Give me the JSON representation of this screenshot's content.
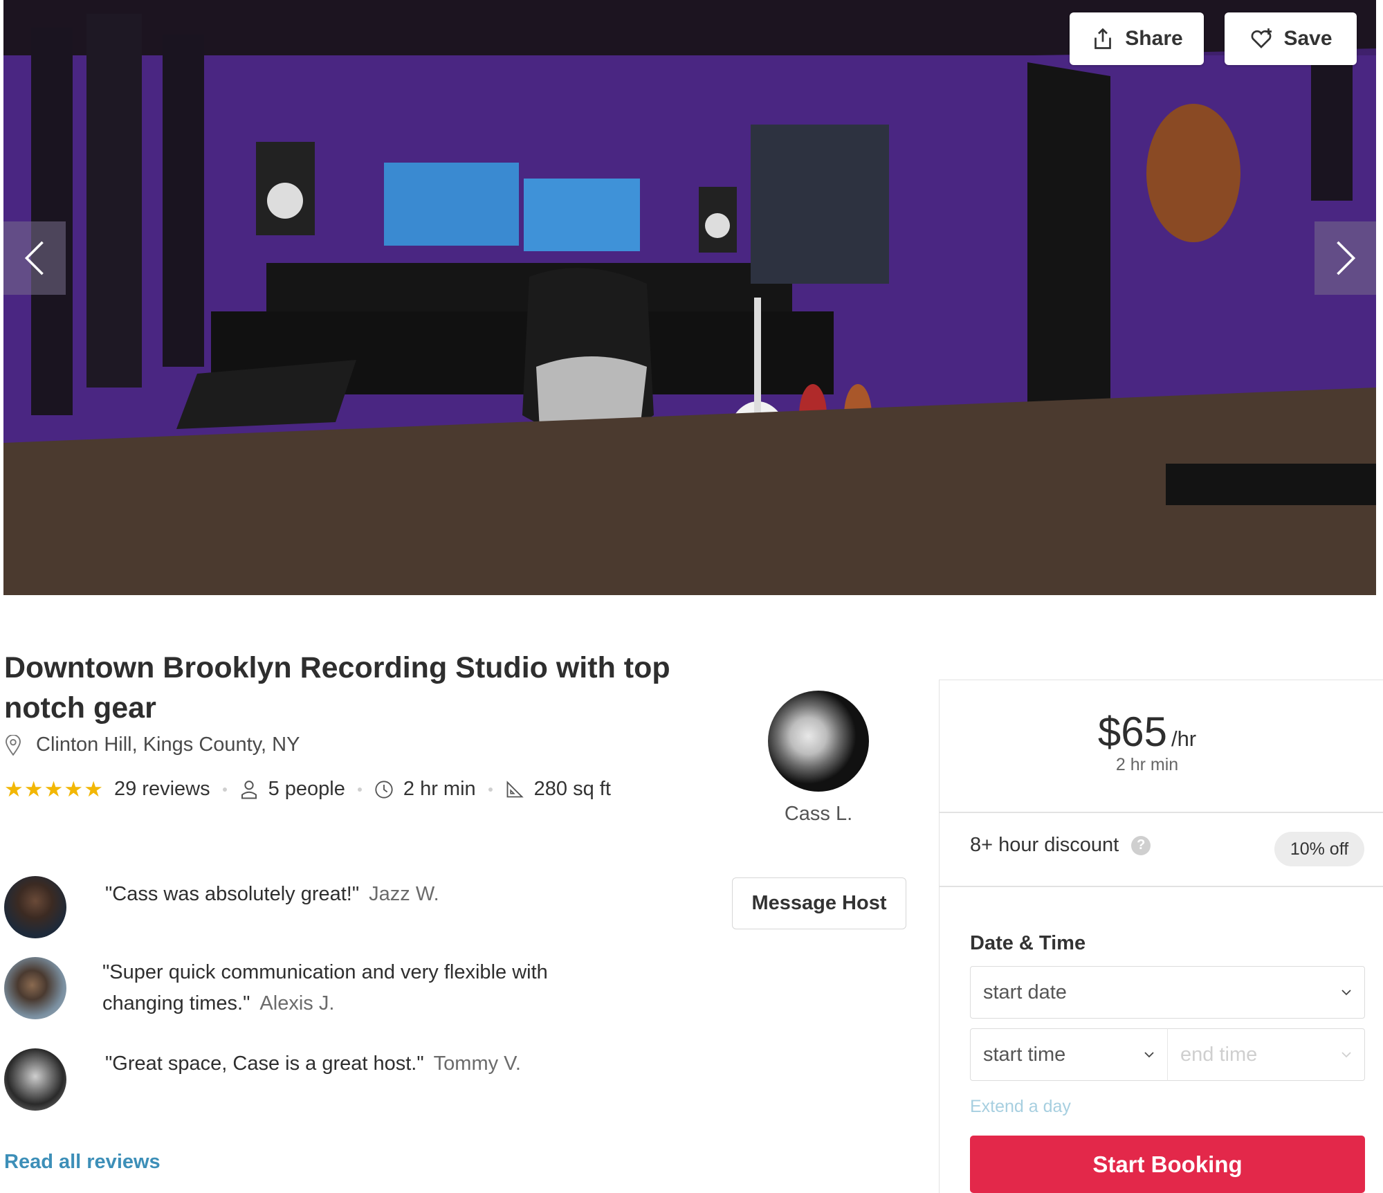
{
  "hero": {
    "share_label": "Share",
    "save_label": "Save"
  },
  "listing": {
    "title": "Downtown Brooklyn Recording Studio with top notch gear",
    "location": "Clinton Hill, Kings County, NY",
    "rating_stars": 5,
    "reviews_count": "29 reviews",
    "capacity": "5 people",
    "min_hours": "2 hr min",
    "area": "280 sq ft"
  },
  "host": {
    "name": "Cass L.",
    "message_label": "Message Host"
  },
  "reviews": [
    {
      "quote": "\"Cass was absolutely great!\"",
      "author": "Jazz W."
    },
    {
      "quote": "\"Super quick communication and very flexible with changing times.\"",
      "author": "Alexis J."
    },
    {
      "quote": "\"Great space, Case is a great host.\"",
      "author": "Tommy V."
    }
  ],
  "read_all_label": "Read all reviews",
  "booking": {
    "price": "$65",
    "price_unit": "/hr",
    "min_hours": "2 hr min",
    "discount_label": "8+ hour discount",
    "discount_value": "10% off",
    "date_time_label": "Date & Time",
    "start_date_placeholder": "start date",
    "start_time_placeholder": "start time",
    "end_time_placeholder": "end time",
    "extend_label": "Extend a day",
    "start_booking_label": "Start Booking"
  },
  "colors": {
    "accent_pink": "#e3284a",
    "link_blue": "#3d8fb8",
    "star_gold": "#f2b705"
  }
}
